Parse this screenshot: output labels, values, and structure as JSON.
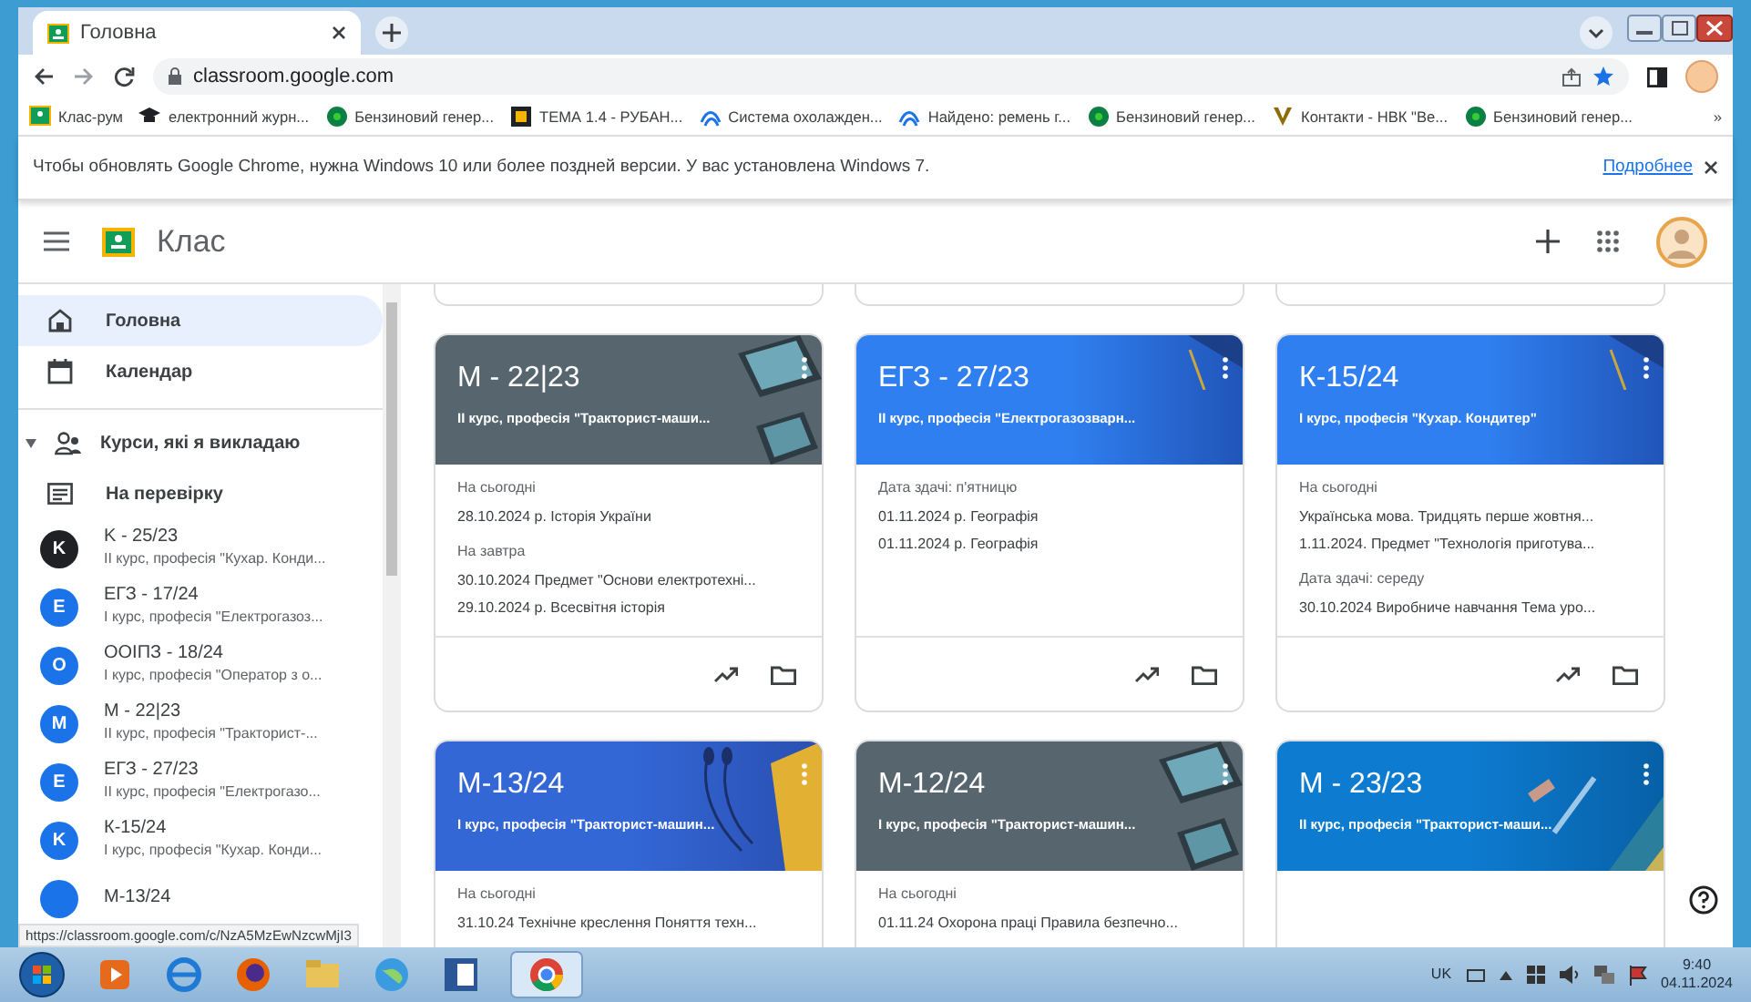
{
  "browser": {
    "tab_title": "Головна",
    "address": "classroom.google.com",
    "more": "»",
    "bookmarks": [
      {
        "label": "Клас-рум",
        "kind": "classroom"
      },
      {
        "label": "електронний журн...",
        "kind": "cap"
      },
      {
        "label": "Бензиновий генер...",
        "kind": "dot"
      },
      {
        "label": "ТЕМА 1.4 - РУБАН...",
        "kind": "square"
      },
      {
        "label": "Система охолажден...",
        "kind": "wave"
      },
      {
        "label": "Найдено: ремень г...",
        "kind": "wave"
      },
      {
        "label": "Бензиновий генер...",
        "kind": "dot"
      },
      {
        "label": "Контакти - НВК \"Ве...",
        "kind": "v"
      },
      {
        "label": "Бензиновий генер...",
        "kind": "dot"
      }
    ]
  },
  "info_bar": {
    "message": "Чтобы обновлять Google Chrome, нужна Windows 10 или более поздней версии. У вас установлена Windows 7.",
    "link": "Подробнее"
  },
  "app": {
    "title": "Клас"
  },
  "sidebar": {
    "nav": [
      {
        "label": "Головна",
        "kind": "home",
        "selected": true
      },
      {
        "label": "Календар",
        "kind": "calendar",
        "selected": false
      }
    ],
    "teaching": {
      "label": "Курси, які я викладаю",
      "expanded": true
    },
    "review": "На перевірку",
    "courses": [
      {
        "initial": "K",
        "title": "K - 25/23",
        "subtitle": "ІІ курс, професія \"Кухар. Конди...",
        "color": "#202124"
      },
      {
        "initial": "E",
        "title": "ЕГЗ - 17/24",
        "subtitle": "І курс, професія \"Електрогазоз...",
        "color": "#1a73e8"
      },
      {
        "initial": "O",
        "title": "ООІПЗ - 18/24",
        "subtitle": "І курс, професія \"Оператор з о...",
        "color": "#1a73e8"
      },
      {
        "initial": "M",
        "title": "М - 22|23",
        "subtitle": "ІІ курс, професія \"Тракторист-...",
        "color": "#1a73e8"
      },
      {
        "initial": "E",
        "title": "ЕГЗ - 27/23",
        "subtitle": "ІІ курс, професія \"Електрогазо...",
        "color": "#1a73e8"
      },
      {
        "initial": "K",
        "title": "К-15/24",
        "subtitle": "І курс, професія \"Кухар. Конди...",
        "color": "#1a73e8"
      },
      {
        "title": "М-13/24",
        "color": "#1a73e8"
      }
    ]
  },
  "cards": [
    {
      "title": "М - 22|23",
      "subtitle": "ІІ курс, професія \"Тракторист-маши...",
      "kind": "tablets",
      "sections": [
        {
          "heading": "На сьогодні",
          "lines": [
            "28.10.2024 р. Історія України"
          ]
        },
        {
          "heading": "На завтра",
          "lines": [
            "30.10.2024 Предмет \"Основи електротехні...",
            "29.10.2024 р. Всесвітня історія"
          ]
        }
      ]
    },
    {
      "title": "ЕГЗ - 27/23",
      "subtitle": "ІІ курс, професія \"Електрогазозварн...",
      "kind": "graduation",
      "sections": [
        {
          "heading": "Дата здачі: п'ятницю",
          "lines": [
            "01.11.2024 р. Географія",
            "01.11.2024 р. Географія"
          ]
        }
      ]
    },
    {
      "title": "К-15/24",
      "subtitle": "І курс, професія \"Кухар. Кондитер\"",
      "kind": "graduation",
      "sections": [
        {
          "heading": "На сьогодні",
          "lines": [
            "Українська мова. Тридцять перше жовтня...",
            "1.11.2024. Предмет \"Технологія приготува..."
          ]
        },
        {
          "heading": "Дата здачі: середу",
          "lines": [
            "30.10.2024 Виробниче навчання Тема уро..."
          ]
        }
      ]
    },
    {
      "title": "М-13/24",
      "subtitle": "І курс, професія \"Тракторист-машин...",
      "kind": "headphones",
      "sections": [
        {
          "heading": "На сьогодні",
          "lines": [
            "31.10.24 Технічне креслення Поняття техн..."
          ]
        }
      ]
    },
    {
      "title": "М-12/24",
      "subtitle": "І курс, професія \"Тракторист-машин...",
      "kind": "tablets",
      "sections": [
        {
          "heading": "На сьогодні",
          "lines": [
            "01.11.24 Охорона праці Правила безпечно..."
          ]
        }
      ]
    },
    {
      "title": "М - 23/23",
      "subtitle": "ІІ курс, професія \"Тракторист-маши...",
      "kind": "pencil"
    }
  ],
  "status_url": "https://classroom.google.com/c/NzA5MzEwNzcwMjI3",
  "taskbar": {
    "language": "UK",
    "time": "9:40",
    "date": "04.11.2024"
  }
}
